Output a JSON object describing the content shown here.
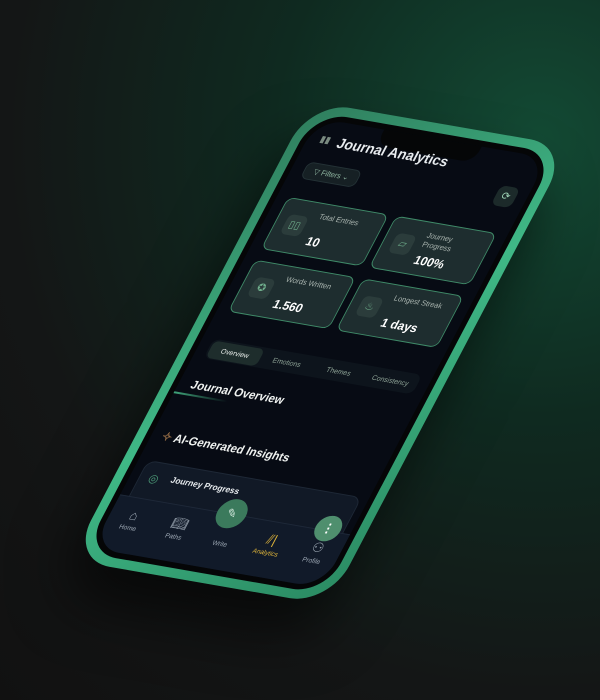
{
  "header": {
    "title": "Journal Analytics",
    "filters_label": "Filters"
  },
  "stats": [
    {
      "label": "Total Entries",
      "value": "10",
      "icon": "book-icon"
    },
    {
      "label": "Journey Progress",
      "value": "100%",
      "icon": "map-icon"
    },
    {
      "label": "Words Written",
      "value": "1.560",
      "icon": "award-icon"
    },
    {
      "label": "Longest Streak",
      "value": "1 days",
      "icon": "flame-icon"
    }
  ],
  "tabs": [
    "Overview",
    "Emotions",
    "Themes",
    "Consistency"
  ],
  "sections": {
    "overview": "Journal Overview",
    "insights": "AI-Generated Insights",
    "progress": "Journey Progress"
  },
  "nav": [
    "Home",
    "Paths",
    "Write",
    "Analytics",
    "Profile"
  ],
  "colors": {
    "accent": "#3fb886",
    "active_nav": "#e0b53a"
  }
}
